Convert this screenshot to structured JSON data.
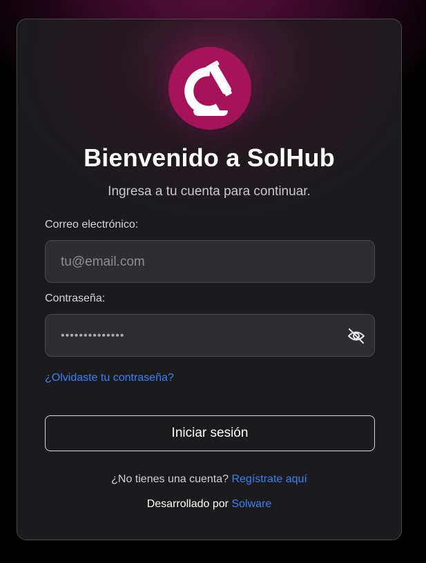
{
  "login": {
    "title": "Bienvenido a SolHub",
    "subtitle": "Ingresa a tu cuenta para continuar.",
    "email_label": "Correo electrónico:",
    "email_placeholder": "tu@email.com",
    "password_label": "Contraseña:",
    "password_value": "••••••••••••••",
    "forgot_link": "¿Olvidaste tu contraseña?",
    "submit_label": "Iniciar sesión",
    "no_account_text": "¿No tienes una cuenta?",
    "register_link": "Regístrate aquí",
    "developed_by_text": "Desarrollado por",
    "developer_link": "Solware"
  },
  "icons": {
    "logo": "microscope-logo-icon",
    "password_toggle": "eye-off-icon"
  },
  "colors": {
    "brand": "#a5135b",
    "link": "#3b82f6",
    "card_background": "#1b1b1d",
    "input_background": "#2e2e30"
  }
}
